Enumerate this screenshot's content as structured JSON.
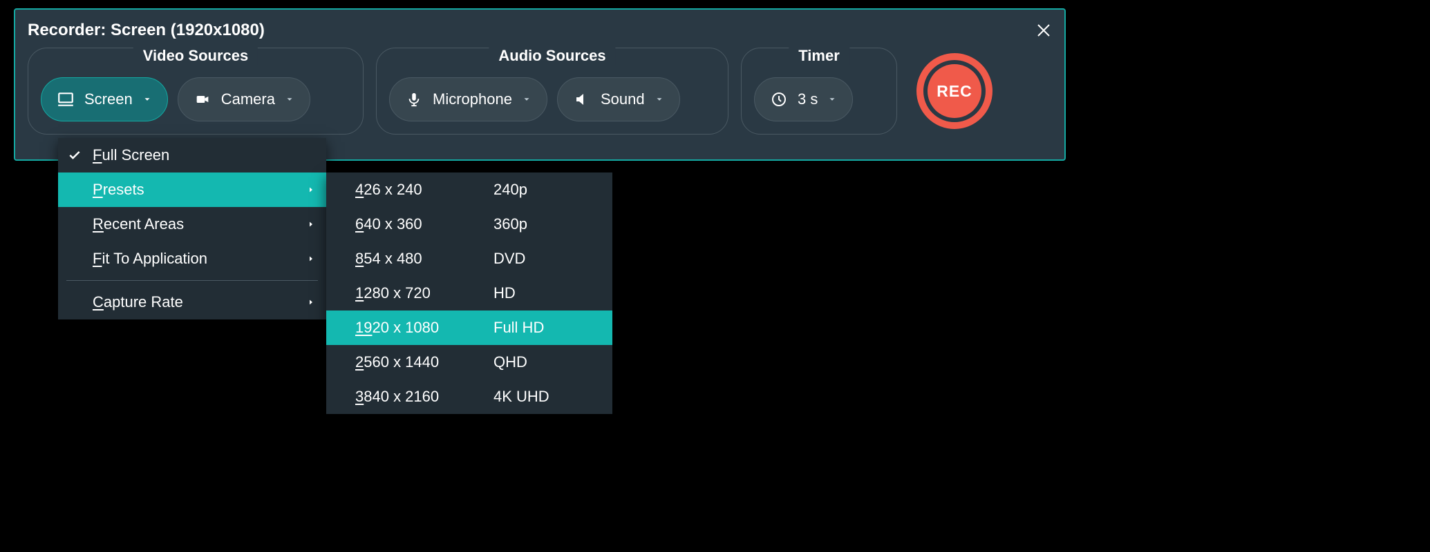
{
  "titlebar": {
    "text": "Recorder: Screen (1920x1080)"
  },
  "groups": {
    "video": {
      "label": "Video Sources"
    },
    "audio": {
      "label": "Audio Sources"
    },
    "timer": {
      "label": "Timer"
    }
  },
  "pills": {
    "screen": "Screen",
    "camera": "Camera",
    "microphone": "Microphone",
    "sound": "Sound",
    "timer_value": "3 s"
  },
  "rec": {
    "label": "REC"
  },
  "menu_primary": {
    "full_screen": "Full Screen",
    "presets": "Presets",
    "recent_areas": "Recent Areas",
    "fit_to_application": "Fit To Application",
    "capture_rate": "Capture Rate"
  },
  "menu_primary_accel": {
    "full_screen_rest": "ull Screen",
    "presets_rest": "resets",
    "recent_areas_rest": "ecent Areas",
    "fit_rest": "it To Application",
    "capture_rest": "apture Rate"
  },
  "presets": [
    {
      "res_u": "4",
      "res_rest": "26 x 240",
      "name": "240p",
      "hi": false
    },
    {
      "res_u": "6",
      "res_rest": "40 x 360",
      "name": "360p",
      "hi": false
    },
    {
      "res_u": "8",
      "res_rest": "54 x 480",
      "name": "DVD",
      "hi": false
    },
    {
      "res_u": "1",
      "res_rest": "280 x 720",
      "name": "HD",
      "hi": false
    },
    {
      "res_u": "19",
      "res_rest": "20 x 1080",
      "name": "Full HD",
      "hi": true
    },
    {
      "res_u": "2",
      "res_rest": "560 x 1440",
      "name": "QHD",
      "hi": false
    },
    {
      "res_u": "3",
      "res_rest": "840 x 2160",
      "name": "4K UHD",
      "hi": false
    }
  ]
}
